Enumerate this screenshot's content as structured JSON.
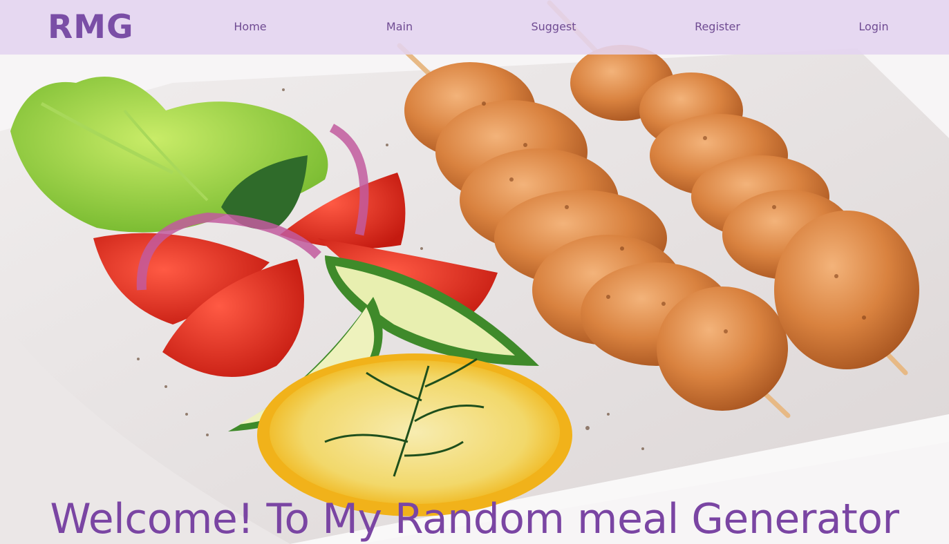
{
  "theme": {
    "navbar_bg": "#e4d4f0",
    "brand_color": "#7a4ea6",
    "link_color": "#6f4b92",
    "headline_color": "#7a45a3"
  },
  "navbar": {
    "brand": "RMG",
    "links": [
      {
        "label": "Home"
      },
      {
        "label": "Main"
      },
      {
        "label": "Suggest"
      },
      {
        "label": "Register"
      },
      {
        "label": "Login"
      }
    ]
  },
  "hero": {
    "headline": "Welcome! To My Random meal Generator"
  }
}
